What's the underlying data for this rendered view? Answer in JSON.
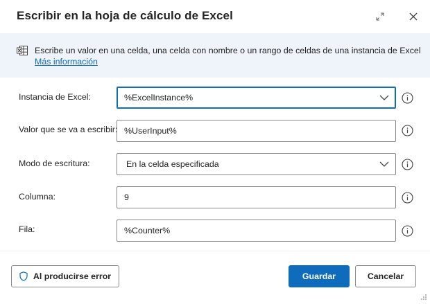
{
  "dialog": {
    "title": "Escribir en la hoja de cálculo de Excel",
    "expand_icon": "expand-icon",
    "close_icon": "close-icon"
  },
  "info": {
    "icon": "excel-worksheet-icon",
    "description": "Escribe un valor en una celda, una celda con nombre o un rango de celdas de una instancia de Excel",
    "link": "Más información"
  },
  "form": {
    "instance": {
      "label": "Instancia de Excel:",
      "value": "%ExcelInstance%"
    },
    "value_to_write": {
      "label": "Valor que se va a escribir:",
      "value": "%UserInput%"
    },
    "write_mode": {
      "label": "Modo de escritura:",
      "value": "En la celda especificada"
    },
    "column": {
      "label": "Columna:",
      "value": "9"
    },
    "row": {
      "label": "Fila:",
      "value": "%Counter%"
    }
  },
  "footer": {
    "on_error_label": "Al producirse error",
    "save_label": "Guardar",
    "cancel_label": "Cancelar"
  },
  "colors": {
    "accent": "#0f6cbd",
    "banner_bg": "#eff4fb",
    "border": "#8a8886",
    "text": "#242424"
  }
}
